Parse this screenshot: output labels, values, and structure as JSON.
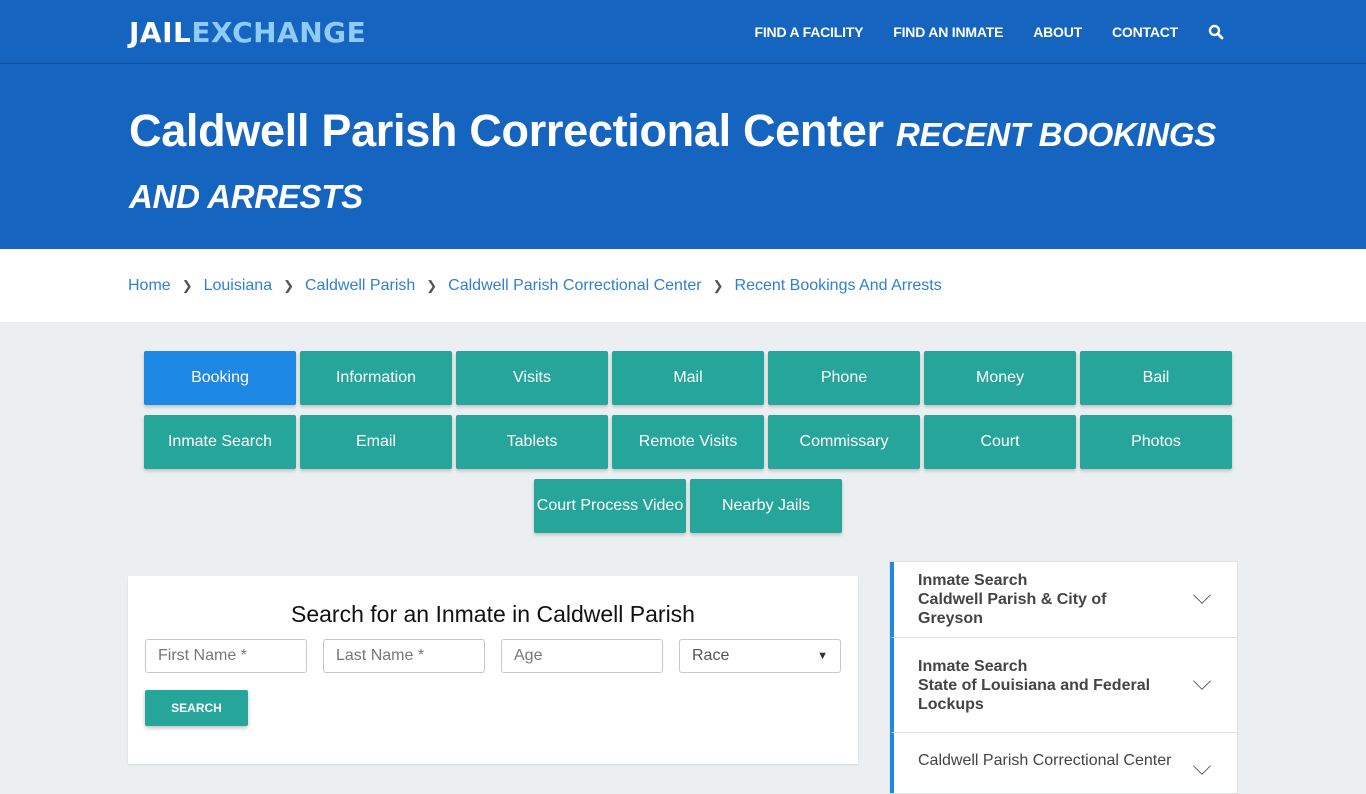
{
  "header": {
    "logo_part1": "JAIL",
    "logo_part2": "EXCHANGE",
    "nav": [
      "FIND A FACILITY",
      "FIND AN INMATE",
      "ABOUT",
      "CONTACT"
    ],
    "search_icon": "search-icon"
  },
  "hero": {
    "title": "Caldwell Parish Correctional Center",
    "subtitle": "Recent Bookings and Arrests"
  },
  "breadcrumb": [
    "Home",
    "Louisiana",
    "Caldwell Parish",
    "Caldwell Parish Correctional Center",
    "Recent Bookings And Arrests"
  ],
  "tiles": [
    {
      "label": "Booking",
      "active": true
    },
    {
      "label": "Information"
    },
    {
      "label": "Visits"
    },
    {
      "label": "Mail"
    },
    {
      "label": "Phone"
    },
    {
      "label": "Money"
    },
    {
      "label": "Bail"
    },
    {
      "label": "Inmate Search"
    },
    {
      "label": "Email"
    },
    {
      "label": "Tablets"
    },
    {
      "label": "Remote Visits"
    },
    {
      "label": "Commissary"
    },
    {
      "label": "Court"
    },
    {
      "label": "Photos"
    },
    {
      "label": "Court Process Video"
    },
    {
      "label": "Nearby Jails"
    }
  ],
  "search": {
    "title": "Search for an Inmate in Caldwell Parish",
    "first_name_placeholder": "First Name *",
    "last_name_placeholder": "Last Name *",
    "age_placeholder": "Age",
    "race_selected": "Race",
    "button": "SEARCH"
  },
  "sidebar": {
    "items": [
      {
        "line1": "Inmate Search",
        "line2": "Caldwell Parish & City of Greyson"
      },
      {
        "line1": "Inmate Search",
        "line2": "State of Louisiana and Federal Lockups"
      },
      {
        "line1": "Caldwell Parish Correctional Center",
        "line2": ""
      }
    ]
  },
  "colors": {
    "brand_blue": "#1565c0",
    "logo_accent": "#90caf9",
    "tile_teal": "#26a69a",
    "tile_active": "#1e88e5",
    "link": "#2f7fd6"
  }
}
